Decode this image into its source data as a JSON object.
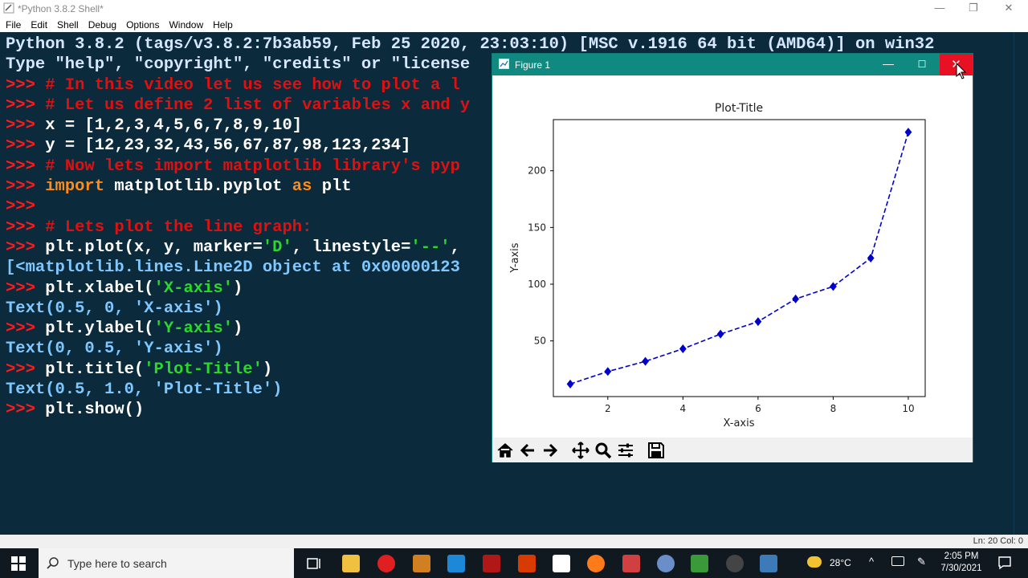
{
  "idle": {
    "title": "*Python 3.8.2 Shell*",
    "menu": [
      "File",
      "Edit",
      "Shell",
      "Debug",
      "Options",
      "Window",
      "Help"
    ],
    "status": "Ln: 20   Col: 0"
  },
  "shell_lines": [
    [
      [
        "out",
        "Python 3.8.2 (tags/v3.8.2:7b3ab59, Feb 25 2020, 23:03:10) [MSC v.1916 64 bit (AMD64)] on win32"
      ]
    ],
    [
      [
        "out",
        "Type \"help\", \"copyright\", \"credits\" or \"license"
      ]
    ],
    [
      [
        "prompt",
        ">>> "
      ],
      [
        "comment",
        "# In this video let us see how to plot a l"
      ]
    ],
    [
      [
        "prompt",
        ">>> "
      ],
      [
        "comment",
        "# Let us define 2 list of variables x and y"
      ]
    ],
    [
      [
        "prompt",
        ">>> "
      ],
      [
        "cmd",
        "x = [1,2,3,4,5,6,7,8,9,10]"
      ]
    ],
    [
      [
        "prompt",
        ">>> "
      ],
      [
        "cmd",
        "y = [12,23,32,43,56,67,87,98,123,234]"
      ]
    ],
    [
      [
        "prompt",
        ">>> "
      ],
      [
        "comment",
        "# Now lets import matplotlib library's pyp"
      ]
    ],
    [
      [
        "prompt",
        ">>> "
      ],
      [
        "kw",
        "import"
      ],
      [
        "cmd",
        " matplotlib.pyplot "
      ],
      [
        "kw",
        "as"
      ],
      [
        "cmd",
        " plt"
      ]
    ],
    [
      [
        "prompt",
        ">>> "
      ]
    ],
    [
      [
        "prompt",
        ">>> "
      ],
      [
        "comment",
        "# Lets plot the line graph:"
      ]
    ],
    [
      [
        "prompt",
        ">>> "
      ],
      [
        "cmd",
        "plt.plot(x, y, marker="
      ],
      [
        "str",
        "'D'"
      ],
      [
        "cmd",
        ", linestyle="
      ],
      [
        "str",
        "'--'"
      ],
      [
        "cmd",
        ","
      ]
    ],
    [
      [
        "res",
        "[<matplotlib.lines.Line2D object at 0x00000123"
      ]
    ],
    [
      [
        "prompt",
        ">>> "
      ],
      [
        "cmd",
        "plt.xlabel("
      ],
      [
        "str",
        "'X-axis'"
      ],
      [
        "cmd",
        ")"
      ]
    ],
    [
      [
        "res",
        "Text(0.5, 0, 'X-axis')"
      ]
    ],
    [
      [
        "prompt",
        ">>> "
      ],
      [
        "cmd",
        "plt.ylabel("
      ],
      [
        "str",
        "'Y-axis'"
      ],
      [
        "cmd",
        ")"
      ]
    ],
    [
      [
        "res",
        "Text(0, 0.5, 'Y-axis')"
      ]
    ],
    [
      [
        "prompt",
        ">>> "
      ],
      [
        "cmd",
        "plt.title("
      ],
      [
        "str",
        "'Plot-Title'"
      ],
      [
        "cmd",
        ")"
      ]
    ],
    [
      [
        "res",
        "Text(0.5, 1.0, 'Plot-Title')"
      ]
    ],
    [
      [
        "prompt",
        ">>> "
      ],
      [
        "cmd",
        "plt.show()"
      ]
    ]
  ],
  "figure": {
    "window_title": "Figure 1",
    "min_glyph": "—",
    "max_glyph": "☐",
    "close_glyph": "✕"
  },
  "chart_data": {
    "type": "line",
    "title": "Plot-Title",
    "xlabel": "X-axis",
    "ylabel": "Y-axis",
    "x": [
      1,
      2,
      3,
      4,
      5,
      6,
      7,
      8,
      9,
      10
    ],
    "series": [
      {
        "values": [
          12,
          23,
          32,
          43,
          56,
          67,
          87,
          98,
          123,
          234
        ]
      }
    ],
    "xticks": [
      2,
      4,
      6,
      8,
      10
    ],
    "yticks": [
      50,
      100,
      150,
      200
    ],
    "xlim": [
      0.55,
      10.45
    ],
    "ylim": [
      0.9,
      245.1
    ],
    "marker": "diamond",
    "linestyle": "dashed",
    "color": "#0000cc",
    "grid": false
  },
  "taskbar": {
    "search_placeholder": "Type here to search",
    "weather": "28°C",
    "time": "2:05 PM",
    "date": "7/30/2021"
  }
}
